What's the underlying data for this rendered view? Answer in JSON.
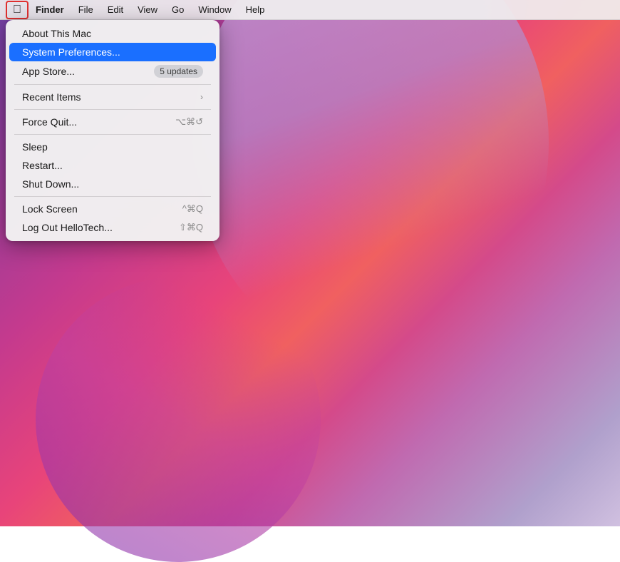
{
  "desktop": {
    "colors": {
      "gradient_start": "#6e3fa3",
      "gradient_end": "#d0c0e0"
    }
  },
  "menubar": {
    "apple_label": "",
    "items": [
      {
        "id": "finder",
        "label": "Finder"
      },
      {
        "id": "file",
        "label": "File"
      },
      {
        "id": "edit",
        "label": "Edit"
      },
      {
        "id": "view",
        "label": "View"
      },
      {
        "id": "go",
        "label": "Go"
      },
      {
        "id": "window",
        "label": "Window"
      },
      {
        "id": "help",
        "label": "Help"
      }
    ]
  },
  "apple_menu": {
    "items": [
      {
        "id": "about",
        "label": "About This Mac",
        "shortcut": "",
        "badge": "",
        "has_submenu": false,
        "highlighted": false,
        "separator_after": false
      },
      {
        "id": "system-prefs",
        "label": "System Preferences...",
        "shortcut": "",
        "badge": "",
        "has_submenu": false,
        "highlighted": true,
        "separator_after": false
      },
      {
        "id": "app-store",
        "label": "App Store...",
        "shortcut": "",
        "badge": "5 updates",
        "has_submenu": false,
        "highlighted": false,
        "separator_after": true
      },
      {
        "id": "recent-items",
        "label": "Recent Items",
        "shortcut": "",
        "badge": "",
        "has_submenu": true,
        "highlighted": false,
        "separator_after": true
      },
      {
        "id": "force-quit",
        "label": "Force Quit...",
        "shortcut": "⌥⌘↺",
        "shortcut_parts": [
          "⌥",
          "⌘",
          "↺"
        ],
        "badge": "",
        "has_submenu": false,
        "highlighted": false,
        "separator_after": true
      },
      {
        "id": "sleep",
        "label": "Sleep",
        "shortcut": "",
        "badge": "",
        "has_submenu": false,
        "highlighted": false,
        "separator_after": false
      },
      {
        "id": "restart",
        "label": "Restart...",
        "shortcut": "",
        "badge": "",
        "has_submenu": false,
        "highlighted": false,
        "separator_after": false
      },
      {
        "id": "shut-down",
        "label": "Shut Down...",
        "shortcut": "",
        "badge": "",
        "has_submenu": false,
        "highlighted": false,
        "separator_after": true
      },
      {
        "id": "lock-screen",
        "label": "Lock Screen",
        "shortcut": "^⌘Q",
        "shortcut_parts": [
          "^",
          "⌘",
          "Q"
        ],
        "badge": "",
        "has_submenu": false,
        "highlighted": false,
        "separator_after": false
      },
      {
        "id": "log-out",
        "label": "Log Out HelloTech...",
        "shortcut": "⇧⌘Q",
        "shortcut_parts": [
          "⇧",
          "⌘",
          "Q"
        ],
        "badge": "",
        "has_submenu": false,
        "highlighted": false,
        "separator_after": false
      }
    ]
  }
}
